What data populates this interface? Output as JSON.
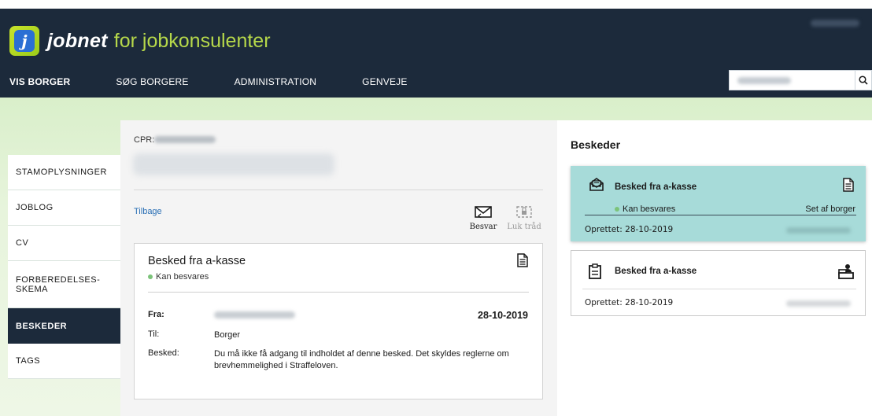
{
  "brand": {
    "name": "jobnet",
    "subtitle": "for jobkonsulenter",
    "badge_letter": "j"
  },
  "nav": {
    "items": [
      {
        "label": "VIS BORGER",
        "active": true
      },
      {
        "label": "SØG BORGERE"
      },
      {
        "label": "ADMINISTRATION"
      },
      {
        "label": "GENVEJE"
      }
    ]
  },
  "search": {
    "icon": "search-icon"
  },
  "sidebar": {
    "items": [
      {
        "label": "STAMOPLYSNINGER"
      },
      {
        "label": "JOBLOG"
      },
      {
        "label": "CV"
      },
      {
        "label": "FORBEREDELSES-\nSKEMA"
      },
      {
        "label": "BESKEDER",
        "active": true
      },
      {
        "label": "TAGS"
      }
    ]
  },
  "citizen": {
    "cpr_label": "CPR:"
  },
  "actions": {
    "back": "Tilbage",
    "reply": "Besvar",
    "close_thread": "Luk tråd"
  },
  "message": {
    "title": "Besked fra a-kasse",
    "status": "Kan besvares",
    "from_label": "Fra:",
    "date": "28-10-2019",
    "to_label": "Til:",
    "to_value": "Borger",
    "body_label": "Besked:",
    "body": "Du må ikke få adgang til indholdet af denne besked. Det skyldes reglerne om brevhemmelighed i Straffeloven."
  },
  "messages_panel": {
    "title": "Beskeder",
    "threads": [
      {
        "title": "Besked fra a-kasse",
        "status": "Kan besvares",
        "seen": "Set af borger",
        "created": "Oprettet: 28-10-2019"
      },
      {
        "title": "Besked fra a-kasse",
        "created": "Oprettet: 28-10-2019"
      }
    ]
  },
  "colors": {
    "header": "#1c2a3b",
    "accent_green": "#b6d84a",
    "selected_thread": "#a7dbd9",
    "status_dot": "#7cc37a",
    "link": "#2a6fb5"
  }
}
